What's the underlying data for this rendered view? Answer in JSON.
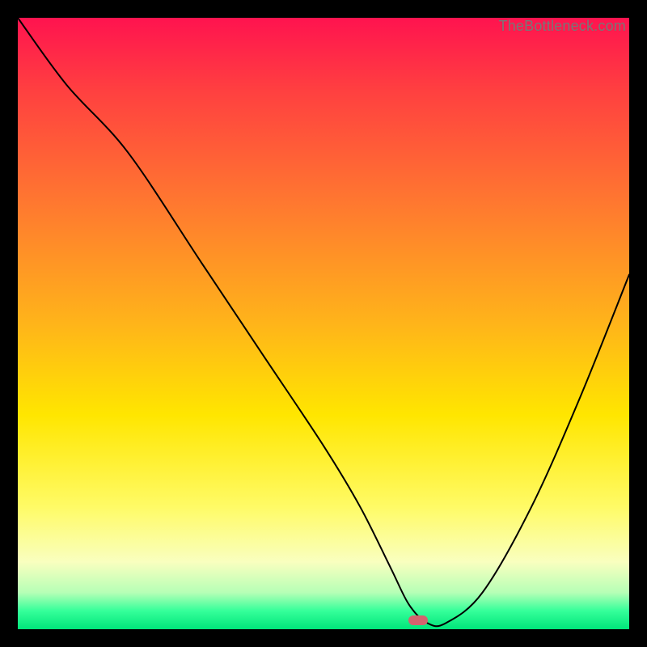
{
  "watermark": "TheBottleneck.com",
  "marker": {
    "x_frac": 0.655,
    "y_frac": 0.985,
    "color": "#d4636e"
  },
  "chart_data": {
    "type": "line",
    "title": "",
    "xlabel": "",
    "ylabel": "",
    "xlim": [
      0,
      100
    ],
    "ylim": [
      0,
      100
    ],
    "grid": false,
    "legend": false,
    "series": [
      {
        "name": "bottleneck-curve",
        "x": [
          0,
          8,
          18,
          30,
          40,
          50,
          56,
          61,
          64,
          67,
          70,
          76,
          84,
          92,
          100
        ],
        "y": [
          100,
          89,
          78,
          60,
          45,
          30,
          20,
          10,
          4,
          1,
          1,
          6,
          20,
          38,
          58
        ]
      }
    ],
    "annotations": []
  },
  "gradient_stops": [
    {
      "pos": 0,
      "color": "#ff134f"
    },
    {
      "pos": 12,
      "color": "#ff4040"
    },
    {
      "pos": 30,
      "color": "#ff7730"
    },
    {
      "pos": 50,
      "color": "#ffb41a"
    },
    {
      "pos": 65,
      "color": "#ffe600"
    },
    {
      "pos": 80,
      "color": "#fffb66"
    },
    {
      "pos": 89,
      "color": "#f9ffbf"
    },
    {
      "pos": 94,
      "color": "#b6ffb6"
    },
    {
      "pos": 97,
      "color": "#35ff9a"
    },
    {
      "pos": 100,
      "color": "#00e57a"
    }
  ]
}
